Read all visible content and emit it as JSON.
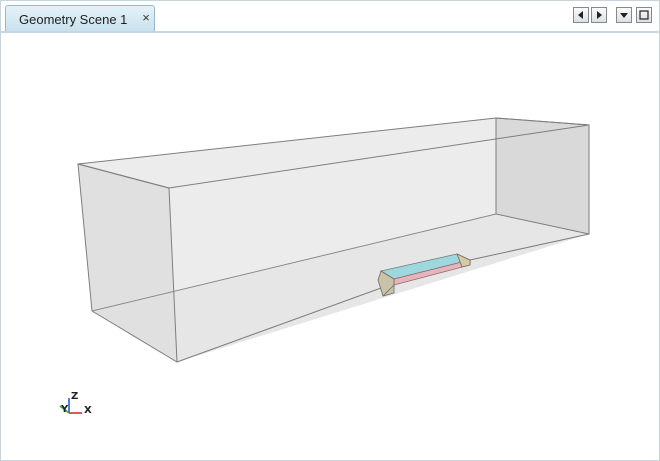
{
  "tabs": [
    {
      "label": "Geometry Scene 1",
      "close_glyph": "×"
    }
  ],
  "tab_controls": [
    "scroll-left-icon",
    "scroll-right-icon",
    "dropdown-menu-icon",
    "maximize-icon"
  ],
  "triad": {
    "z": "Z",
    "y": "Y",
    "x": "X"
  },
  "colors": {
    "tab_active": "#c9e2ee",
    "box_edge": "#7e7e7e",
    "box_face": "#e4e4e4",
    "part_top": "#9fd8dc",
    "part_side": "#e8b4bc",
    "triad_x": "#d03030",
    "triad_y": "#2fae3c",
    "triad_z": "#2f59d6"
  }
}
